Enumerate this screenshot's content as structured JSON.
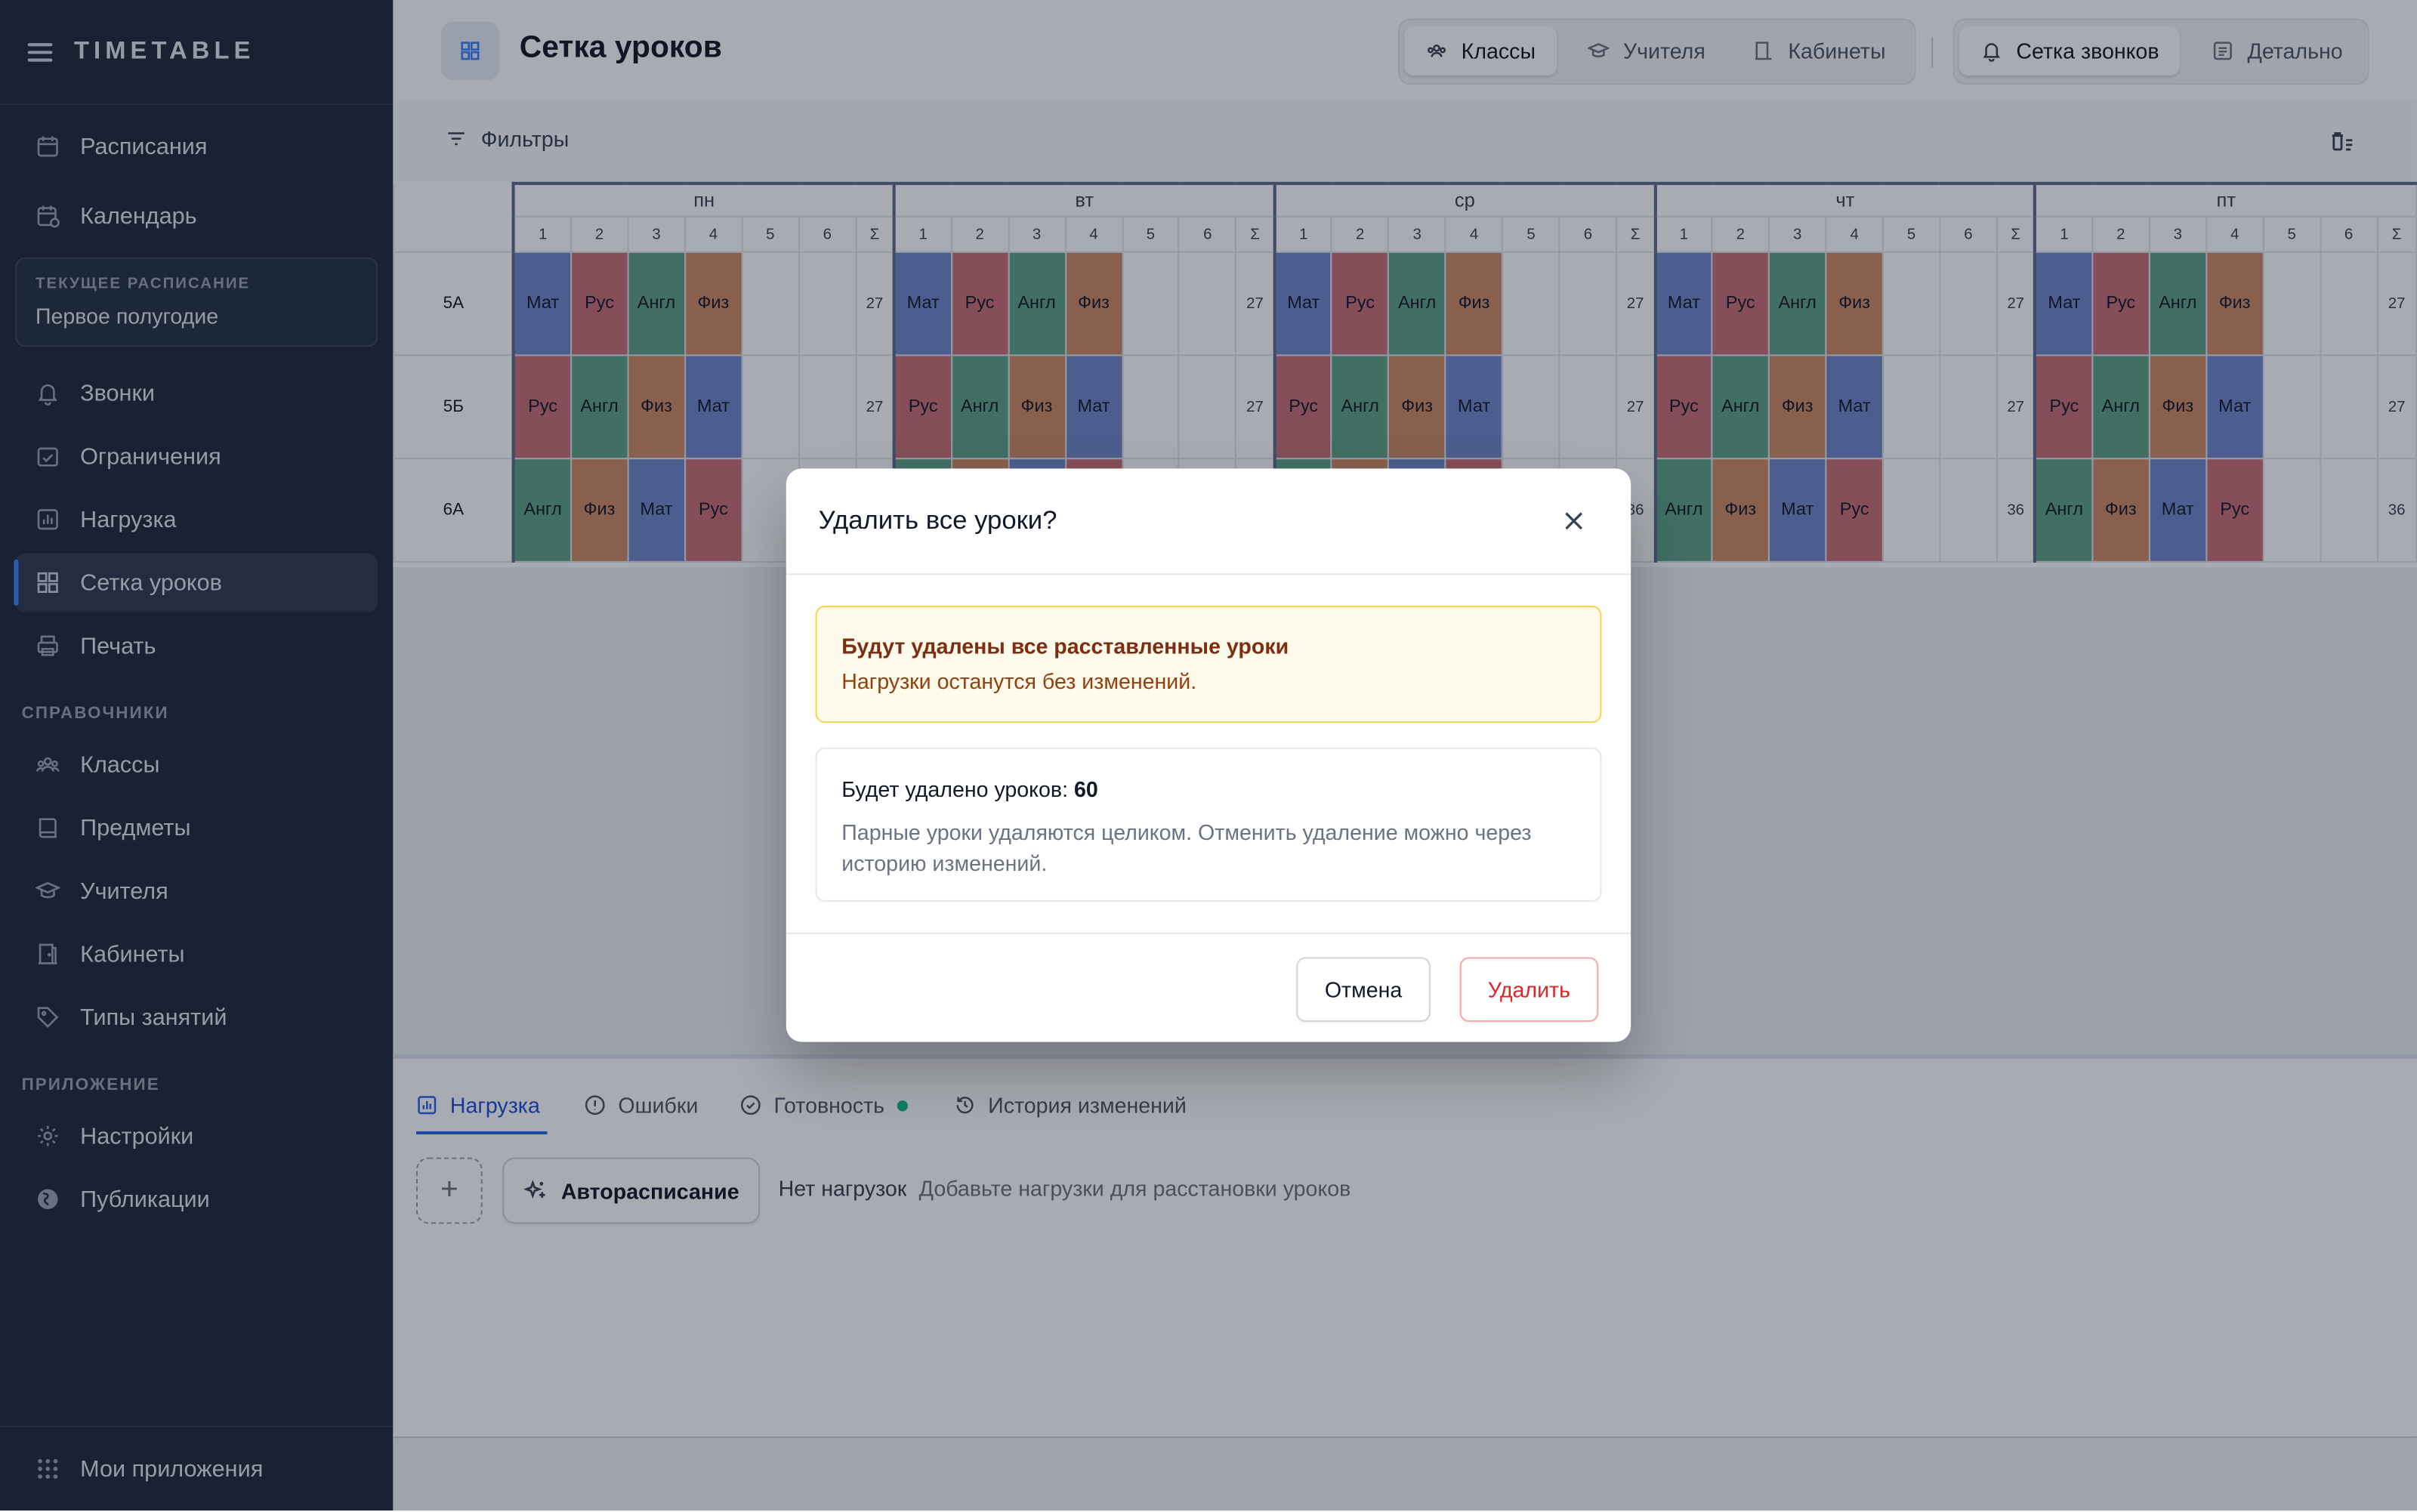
{
  "app": {
    "name": "TIMETABLE"
  },
  "sidebar": {
    "nav_top": [
      {
        "label": "Расписания",
        "icon": "calendar-icon"
      },
      {
        "label": "Календарь",
        "icon": "calendar-clock-icon"
      }
    ],
    "current_schedule": {
      "caption": "ТЕКУЩЕЕ РАСПИСАНИЕ",
      "value": "Первое полугодие"
    },
    "nav_main": [
      {
        "label": "Звонки",
        "icon": "bell-icon"
      },
      {
        "label": "Ограничения",
        "icon": "calendar-check-icon"
      },
      {
        "label": "Нагрузка",
        "icon": "bar-chart-icon"
      },
      {
        "label": "Сетка уроков",
        "icon": "grid-icon",
        "active": true
      },
      {
        "label": "Печать",
        "icon": "printer-icon"
      }
    ],
    "section_refs": "СПРАВОЧНИКИ",
    "nav_refs": [
      {
        "label": "Классы",
        "icon": "users-icon"
      },
      {
        "label": "Предметы",
        "icon": "book-icon"
      },
      {
        "label": "Учителя",
        "icon": "graduation-cap-icon"
      },
      {
        "label": "Кабинеты",
        "icon": "door-icon"
      },
      {
        "label": "Типы занятий",
        "icon": "tag-icon"
      }
    ],
    "section_app": "ПРИЛОЖЕНИЕ",
    "nav_app": [
      {
        "label": "Настройки",
        "icon": "gear-icon"
      },
      {
        "label": "Публикации",
        "icon": "globe-icon"
      }
    ],
    "bottom": {
      "label": "Мои приложения",
      "icon": "apps-grid-icon"
    }
  },
  "header": {
    "title": "Сетка уроков",
    "view_tabs": [
      {
        "label": "Классы",
        "active": true
      },
      {
        "label": "Учителя"
      },
      {
        "label": "Кабинеты"
      }
    ],
    "mode_tabs": [
      {
        "label": "Сетка звонков",
        "active": true
      },
      {
        "label": "Детально"
      }
    ]
  },
  "filters": {
    "label": "Фильтры"
  },
  "grid": {
    "days": [
      "пн",
      "вт",
      "ср",
      "чт",
      "пт"
    ],
    "periods": [
      "1",
      "2",
      "3",
      "4",
      "5",
      "6"
    ],
    "sum_label": "Σ",
    "rows": [
      {
        "class": "5А",
        "lessons": [
          "Мат",
          "Рус",
          "Англ",
          "Физ"
        ],
        "total": "27"
      },
      {
        "class": "5Б",
        "lessons": [
          "Рус",
          "Англ",
          "Физ",
          "Мат"
        ],
        "total": "27"
      },
      {
        "class": "6А",
        "lessons": [
          "Англ",
          "Физ",
          "Мат",
          "Рус"
        ],
        "total": "36"
      }
    ],
    "subject_colors": {
      "Мат": "#6f87c8",
      "Рус": "#c96e72",
      "Англ": "#5fa285",
      "Физ": "#cf8a63"
    }
  },
  "bottom_panel": {
    "tabs": [
      {
        "label": "Нагрузка",
        "active": true
      },
      {
        "label": "Ошибки"
      },
      {
        "label": "Готовность"
      },
      {
        "label": "История изменений"
      }
    ],
    "add_label": "+",
    "auto_label": "Авторасписание",
    "empty_title": "Нет нагрузок",
    "empty_hint": "Добавьте нагрузки для расстановки уроков"
  },
  "modal": {
    "title": "Удалить все уроки?",
    "warning_title": "Будут удалены все расставленные уроки",
    "warning_text": "Нагрузки останутся без изменений.",
    "count_prefix": "Будет удалено уроков: ",
    "count": "60",
    "note": "Парные уроки удаляются целиком. Отменить удаление можно через историю изменений.",
    "cancel": "Отмена",
    "confirm": "Удалить"
  }
}
